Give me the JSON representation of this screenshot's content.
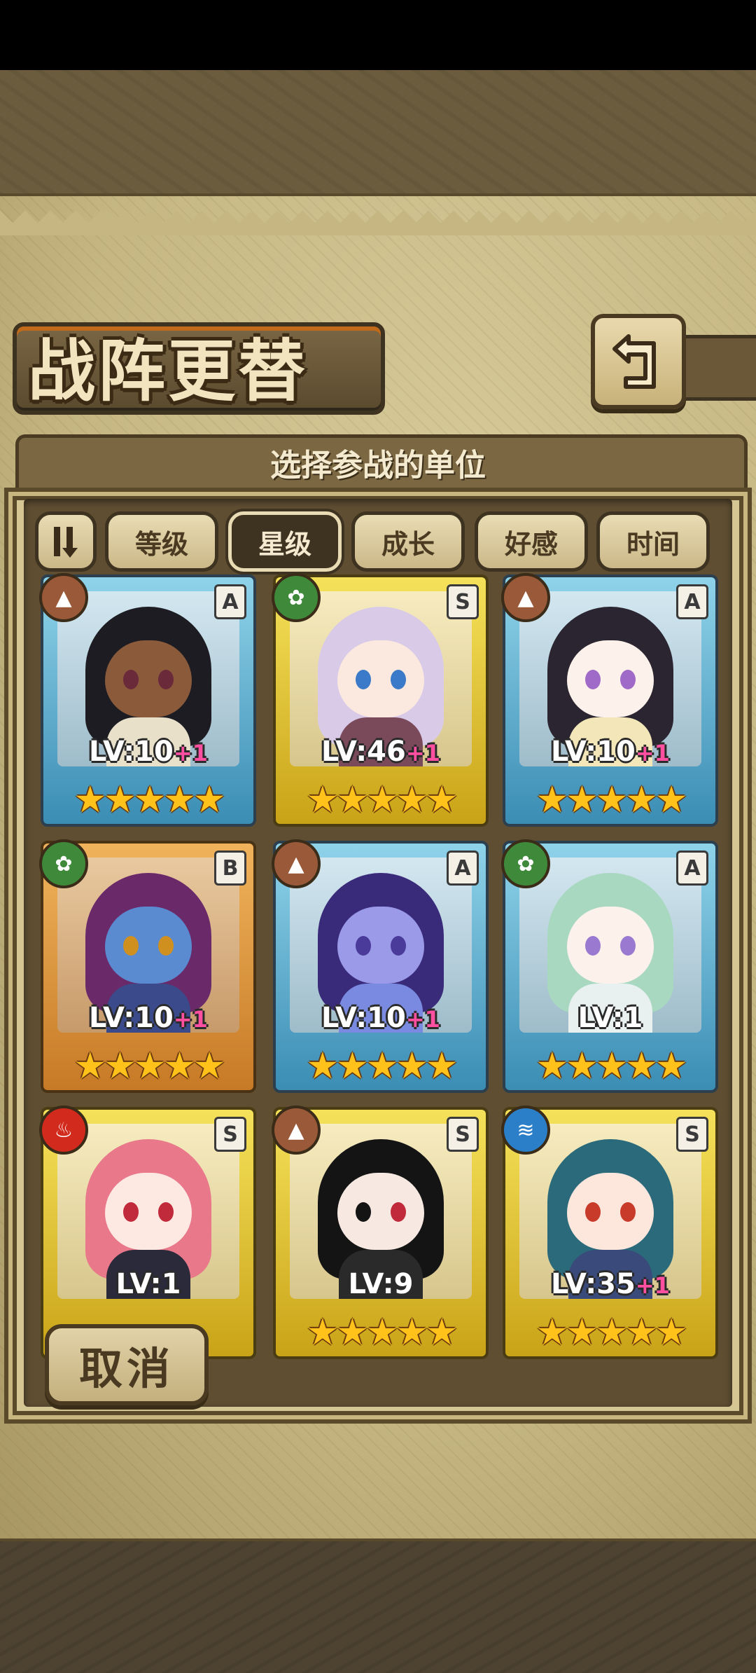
{
  "screen": {
    "title": "战阵更替",
    "subtitle": "选择参战的单位"
  },
  "toolbar": {
    "sort_toggle_icon": "sort-toggle-icon",
    "tabs": [
      {
        "label": "等级",
        "active": false
      },
      {
        "label": "星级",
        "active": true
      },
      {
        "label": "成长",
        "active": false
      },
      {
        "label": "好感",
        "active": false
      },
      {
        "label": "时间",
        "active": false
      }
    ]
  },
  "units": [
    {
      "element": "earth",
      "rank": "A",
      "level": "LV:10",
      "bonus": "+1",
      "stars": "★★★★★"
    },
    {
      "element": "nature",
      "rank": "S",
      "level": "LV:46",
      "bonus": "+1",
      "stars": "★★★★★"
    },
    {
      "element": "earth",
      "rank": "A",
      "level": "LV:10",
      "bonus": "+1",
      "stars": "★★★★★"
    },
    {
      "element": "nature",
      "rank": "B",
      "level": "LV:10",
      "bonus": "+1",
      "stars": "★★★★★"
    },
    {
      "element": "earth",
      "rank": "A",
      "level": "LV:10",
      "bonus": "+1",
      "stars": "★★★★★"
    },
    {
      "element": "nature",
      "rank": "A",
      "level": "LV:1",
      "bonus": "",
      "stars": "★★★★★"
    },
    {
      "element": "fire",
      "rank": "S",
      "level": "LV:1",
      "bonus": "",
      "stars": ""
    },
    {
      "element": "earth",
      "rank": "S",
      "level": "LV:9",
      "bonus": "",
      "stars": "★★★★★"
    },
    {
      "element": "water",
      "rank": "S",
      "level": "LV:35",
      "bonus": "+1",
      "stars": "★★★★★"
    }
  ],
  "cancel_label": "取消",
  "colors": {
    "rank_a_frame": "#3b8db4",
    "rank_s_frame": "#c9a317",
    "rank_b_frame": "#c77a26",
    "bonus": "#ff4fa0",
    "star": "#ffc21a"
  }
}
